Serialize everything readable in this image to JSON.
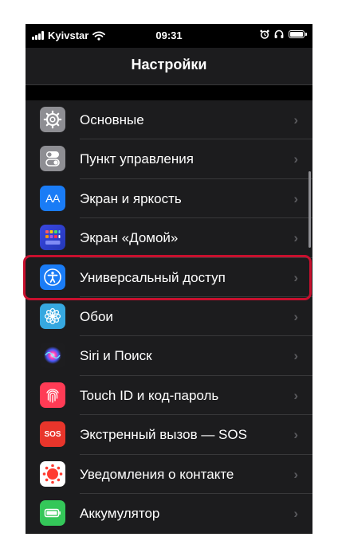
{
  "status_bar": {
    "carrier": "Kyivstar",
    "time": "09:31"
  },
  "header": {
    "title": "Настройки"
  },
  "items": [
    {
      "label": "Основные",
      "icon": "gear-icon",
      "color": "#8e8e93"
    },
    {
      "label": "Пункт управления",
      "icon": "toggles-icon",
      "color": "#8e8e93"
    },
    {
      "label": "Экран и яркость",
      "icon": "display-aa-icon",
      "color": "#1a7cf6",
      "glyph": "AA"
    },
    {
      "label": "Экран «Домой»",
      "icon": "home-grid-icon",
      "color": "#2b3bd6"
    },
    {
      "label": "Универсальный доступ",
      "icon": "accessibility-icon",
      "color": "#1a7cf6"
    },
    {
      "label": "Обои",
      "icon": "flower-icon",
      "color": "#36a8e0"
    },
    {
      "label": "Siri и Поиск",
      "icon": "siri-icon",
      "color": "#1d1d1f"
    },
    {
      "label": "Touch ID и код-пароль",
      "icon": "fingerprint-icon",
      "color": "#ff3b55"
    },
    {
      "label": "Экстренный вызов — SOS",
      "icon": "sos-icon",
      "color": "#e8352b",
      "glyph": "SOS"
    },
    {
      "label": "Уведомления о контакте",
      "icon": "exposure-icon",
      "color": "#ffffff"
    },
    {
      "label": "Аккумулятор",
      "icon": "battery-icon",
      "color": "#34c759"
    }
  ],
  "highlight_color": "#c8102e"
}
